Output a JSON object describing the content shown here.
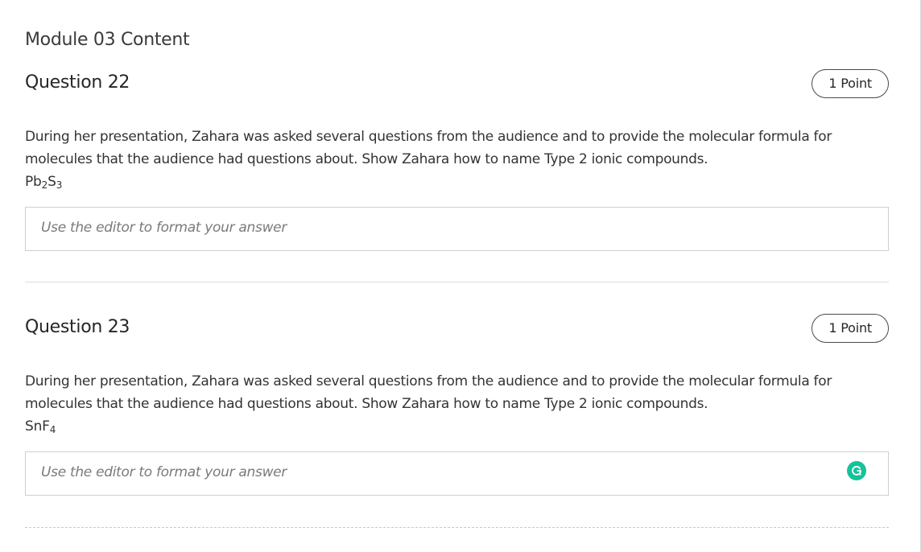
{
  "module": {
    "title": "Module 03 Content"
  },
  "questions": [
    {
      "title": "Question 22",
      "points": "1 Point",
      "prompt": "During her presentation, Zahara was asked several questions from the audience and to provide the molecular formula for molecules that the audience had questions about. Show Zahara how to name Type 2 ionic compounds.",
      "formula": {
        "el1": "Pb",
        "sub1": "2",
        "el2": "S",
        "sub2": "3"
      },
      "answer_placeholder": "Use the editor to format your answer"
    },
    {
      "title": "Question 23",
      "points": "1 Point",
      "prompt": "During her presentation, Zahara was asked several questions from the audience and to provide the molecular formula for molecules that the audience had questions about. Show Zahara how to name Type 2 ionic compounds.",
      "formula": {
        "el1": "SnF",
        "sub1": "4"
      },
      "answer_placeholder": "Use the editor to format your answer",
      "assistant_icon": "grammarly-icon",
      "assistant_color": "#15c39a"
    }
  ]
}
